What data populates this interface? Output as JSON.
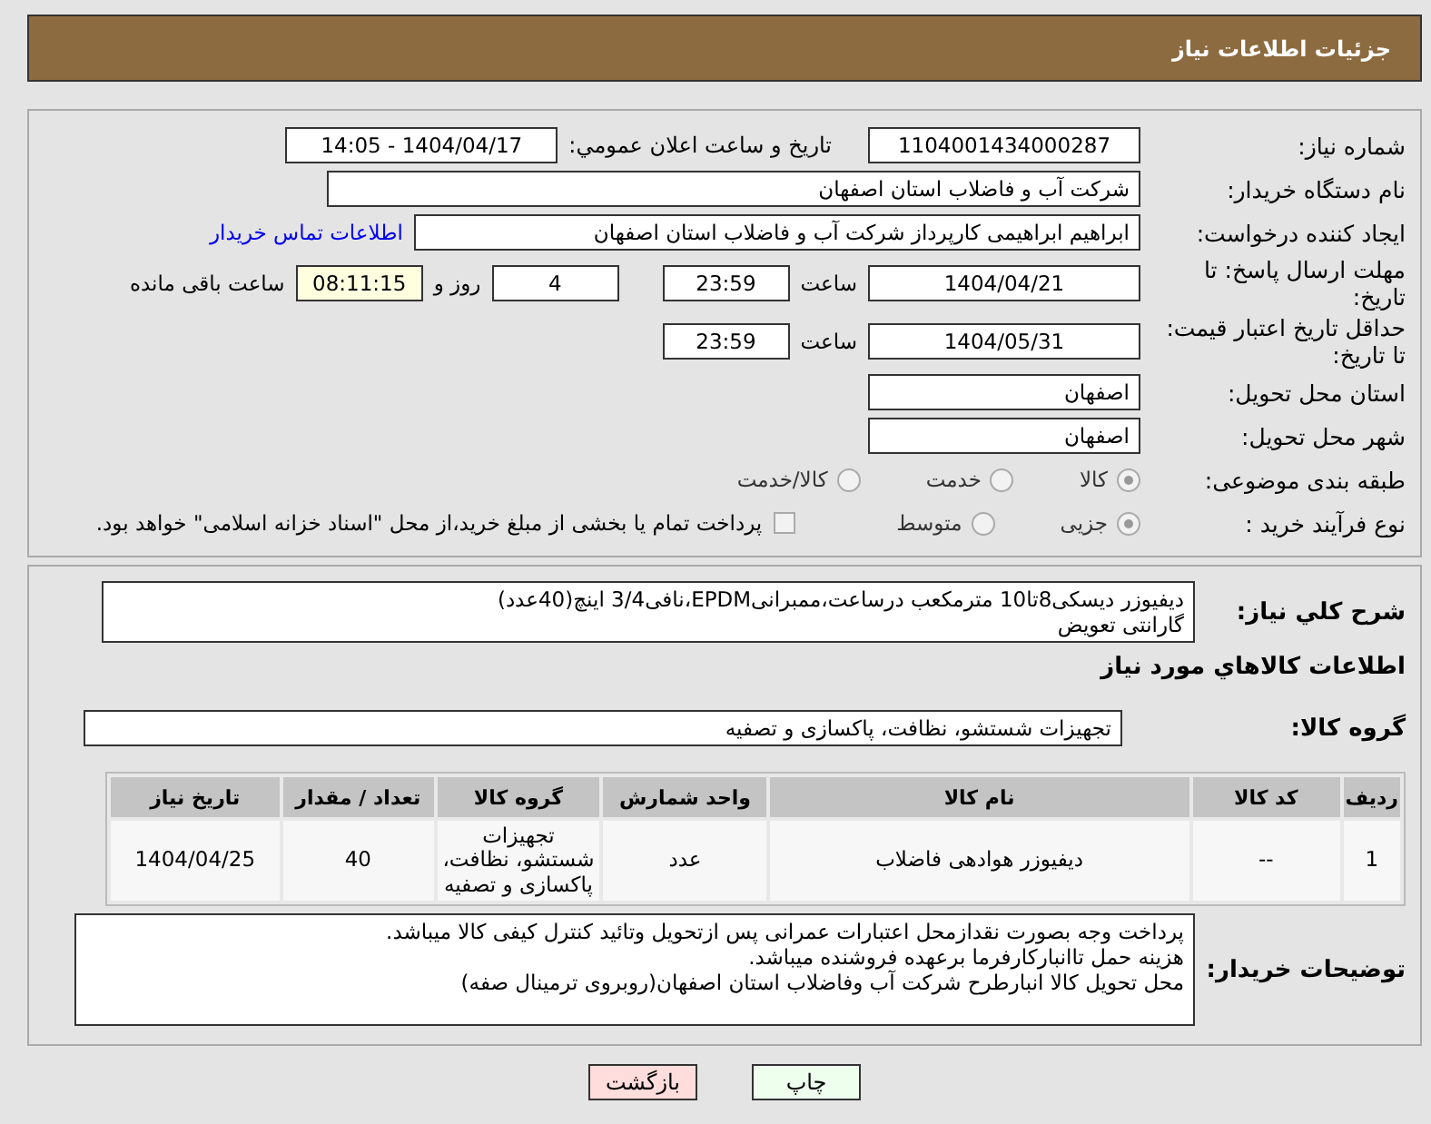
{
  "header": {
    "title": "جزئیات اطلاعات نیاز"
  },
  "need_number": {
    "label": "شماره نیاز:",
    "value": "1104001434000287"
  },
  "announce": {
    "label": "تاریخ و ساعت اعلان عمومي:",
    "value": "1404/04/17 - 14:05"
  },
  "buyer_org": {
    "label": "نام دستگاه خريدار:",
    "value": "شرکت آب و فاضلاب استان اصفهان"
  },
  "requester": {
    "label": "ایجاد کننده درخواست:",
    "value": "ابراهیم ابراهیمی کارپرداز شرکت آب و فاضلاب استان اصفهان",
    "link": "اطلاعات تماس خریدار"
  },
  "reply_deadline": {
    "label": "مهلت ارسال پاسخ: تا تاریخ:",
    "date": "1404/04/21",
    "time_label": "ساعت",
    "time": "23:59",
    "days": "4",
    "days_label": "روز و",
    "remaining": "08:11:15",
    "remaining_label": "ساعت باقی مانده"
  },
  "price_validity": {
    "label": "حداقل تاریخ اعتبار قیمت: تا تاریخ:",
    "date": "1404/05/31",
    "time_label": "ساعت",
    "time": "23:59"
  },
  "province": {
    "label": "استان محل تحویل:",
    "value": "اصفهان"
  },
  "city": {
    "label": "شهر محل تحویل:",
    "value": "اصفهان"
  },
  "category": {
    "label": "طبقه بندی موضوعی:",
    "options": [
      {
        "label": "کالا",
        "selected": true
      },
      {
        "label": "خدمت",
        "selected": false
      },
      {
        "label": "کالا/خدمت",
        "selected": false
      }
    ]
  },
  "process": {
    "label": "نوع فرآیند خرید :",
    "options": [
      {
        "label": "جزیی",
        "selected": true
      },
      {
        "label": "متوسط",
        "selected": false
      }
    ],
    "treasury": {
      "checked": false,
      "label": "پرداخت تمام یا بخشی از مبلغ خرید،از محل \"اسناد خزانه اسلامی\" خواهد بود."
    }
  },
  "summary": {
    "label": "شرح کلي نياز:",
    "lines": [
      "دیفیوزر دیسکی8تا10 مترمکعب درساعت،ممبرانیEPDM،نافی3/4 اینچ(40عدد)",
      "گارانتی تعویض"
    ]
  },
  "goods_title": "اطلاعات کالاهاي مورد نياز",
  "goods_group": {
    "label": "گروه کالا:",
    "value": "تجهیزات شستشو، نظافت، پاکسازی و تصفیه"
  },
  "table": {
    "columns": [
      "ردیف",
      "کد کالا",
      "نام کالا",
      "واحد شمارش",
      "گروه کالا",
      "تعداد / مقدار",
      "تاریخ نیاز"
    ],
    "rows": [
      [
        "1",
        "--",
        "دیفیوزر هوادهی فاضلاب",
        "عدد",
        "تجهیزات شستشو، نظافت، پاکسازی و تصفیه",
        "40",
        "1404/04/25"
      ]
    ]
  },
  "buyer_notes": {
    "label": "توضیحات خریدار:",
    "lines": [
      "پرداخت وجه بصورت نقدازمحل اعتبارات عمرانی پس ازتحویل وتائید کنترل کیفی کالا میباشد.",
      "هزینه حمل تاانبارکارفرما برعهده فروشنده میباشد.",
      "محل تحویل کالا انبارطرح شرکت آب وفاضلاب استان اصفهان(روبروی ترمینال صفه)"
    ]
  },
  "buttons": [
    {
      "label": "چاپ",
      "kind": "print"
    },
    {
      "label": "بازگشت",
      "kind": "back"
    }
  ]
}
